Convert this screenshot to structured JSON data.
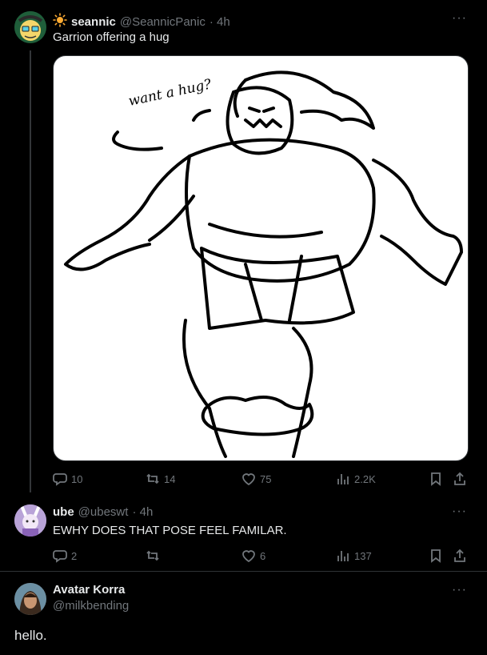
{
  "tweet1": {
    "author_name": "seannic",
    "handle": "@SeannicPanic",
    "time": "· 4h",
    "text": "Garrion offering a hug",
    "image_caption": "want a hug?",
    "replies": "10",
    "retweets": "14",
    "likes": "75",
    "views": "2.2K"
  },
  "tweet2": {
    "author_name": "ube",
    "handle": "@ubeswt",
    "time": "· 4h",
    "text": "EWHY DOES THAT POSE FEEL FAMILAR.",
    "replies": "2",
    "retweets": "",
    "likes": "6",
    "views": "137"
  },
  "compose": {
    "author_name": "Avatar Korra",
    "handle": "@milkbending",
    "text": "hello."
  },
  "colors": {
    "background": "#000000",
    "text": "#e7e9ea",
    "muted": "#71767b",
    "sun": "#ffac33"
  },
  "icons": {
    "more": "more-horizontal",
    "reply": "speech-bubble",
    "retweet": "retweet-arrows",
    "like": "heart",
    "views": "bar-chart",
    "bookmark": "bookmark",
    "share": "share-upload"
  }
}
